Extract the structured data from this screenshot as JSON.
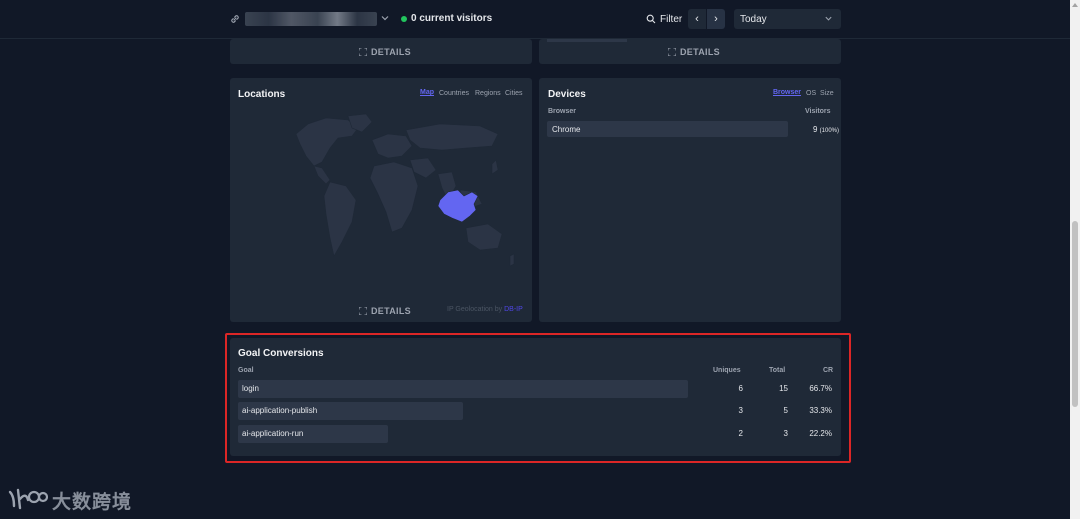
{
  "header": {
    "current_visitors": "0 current visitors",
    "filter_label": "Filter",
    "prev_label": "‹",
    "next_label": "›",
    "period": "Today"
  },
  "top_cards": {
    "details_label": "DETAILS"
  },
  "locations": {
    "title": "Locations",
    "tabs": [
      "Map",
      "Countries",
      "Regions",
      "Cities"
    ],
    "active_tab": "Map",
    "details_label": "DETAILS",
    "geo_credit_prefix": "IP Geolocation by",
    "geo_credit_provider": "DB-IP",
    "highlighted_country_color": "#6366f1"
  },
  "devices": {
    "title": "Devices",
    "tabs": [
      "Browser",
      "OS",
      "Size"
    ],
    "active_tab": "Browser",
    "column_name": "Browser",
    "column_value": "Visitors",
    "rows": [
      {
        "name": "Chrome",
        "visitors": "9",
        "percent": "(100%)",
        "share": 1.0
      }
    ]
  },
  "goal_conversions": {
    "title": "Goal Conversions",
    "columns": {
      "goal": "Goal",
      "uniques": "Uniques",
      "total": "Total",
      "cr": "CR"
    },
    "rows": [
      {
        "goal": "login",
        "uniques": "6",
        "total": "15",
        "cr": "66.7%",
        "share": 1.0
      },
      {
        "goal": "ai-application-publish",
        "uniques": "3",
        "total": "5",
        "cr": "33.3%",
        "share": 0.5
      },
      {
        "goal": "ai-application-run",
        "uniques": "2",
        "total": "3",
        "cr": "22.2%",
        "share": 0.333
      }
    ]
  },
  "watermark": {
    "text": "大数跨境"
  },
  "colors": {
    "accent": "#6366f1",
    "live": "#22c55e",
    "highlight_border": "#dc2626",
    "background": "#111827",
    "card": "#1f2937"
  }
}
